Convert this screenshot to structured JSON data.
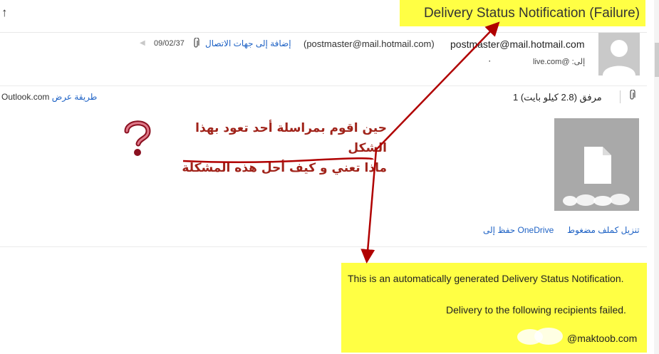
{
  "subject": "Delivery Status Notification (Failure)",
  "header": {
    "sender_email": "postmaster@mail.hotmail.com",
    "sender_display": "(postmaster@mail.hotmail.com)",
    "add_to_contacts": "إضافة إلى جهات الاتصال",
    "date": "09/02/37",
    "to_line": "إلى: @live.com",
    "arabic_mark": "٠"
  },
  "attachments": {
    "view_as_label": "Outlook.com",
    "view_as_link": "طريقة عرض",
    "count_text": "1 مرفق (2.8 كيلو بايت)",
    "download_zip": "تنزيل كملف مضغوط",
    "save_onedrive": "حفظ إلى OneDrive"
  },
  "body": {
    "line1": "This is an automatically generated Delivery Status Notification.",
    "line2": "Delivery to the following recipients failed.",
    "recipient": "@maktoob.com"
  },
  "annotation": {
    "question_line1": "حين اقوم بمراسلة أحد تعود بهذا الشكل",
    "question_line2": "ماذا تعني و كيف أحل هذه المشكلة",
    "highlight_color": "#ffff44",
    "arrow_color": "#b00000"
  },
  "icons": {
    "up": "arrow-up-icon",
    "clip": "paperclip-icon",
    "flag": "flag-icon",
    "avatar": "person-avatar-icon",
    "doc": "document-icon"
  }
}
